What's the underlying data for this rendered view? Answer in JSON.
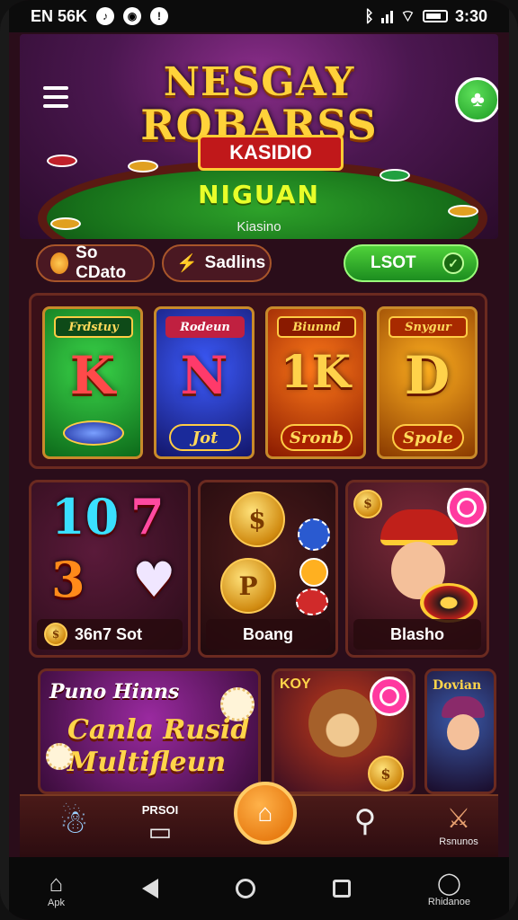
{
  "status_bar": {
    "left_text": "EN 56K",
    "time": "3:30"
  },
  "hero": {
    "title_line1": "NESGAY",
    "title_line2": "ROBARSS",
    "ribbon": "KASIDIO",
    "subtitle": "NIGUAN",
    "caption": "Kiasino"
  },
  "chips": {
    "coin_label": "So CDato",
    "spin_label": "Sadlins",
    "lsot_label": "LSOT"
  },
  "slots": [
    {
      "tag": "Frdstuy",
      "letter": "K",
      "button": "Jot"
    },
    {
      "tag": "Rodeun",
      "letter": "N",
      "button": "Jot"
    },
    {
      "tag": "Biunnd",
      "letter": "1K",
      "button": "Sronb"
    },
    {
      "tag": "Snygur",
      "letter": "D",
      "button": "Spole"
    }
  ],
  "cards": {
    "numbers_caption": "36n7 Sot",
    "coins_caption": "Boang",
    "man_caption": "Blasho",
    "promo_line1": "Puno Hinns",
    "promo_line2": "Canla Rusid",
    "promo_line3": "Multifleun",
    "bear_tag": "KOY",
    "lady_tag": "Dovian"
  },
  "bottom_nav": {
    "item2_label": "PRSOI",
    "item5_label": "Rsnunos"
  },
  "android_nav": {
    "home_label": "Apk",
    "profile_label": "Rhidanoe"
  },
  "colors": {
    "accent_gold": "#ffd23a",
    "accent_green": "#2ea32a",
    "background": "#2a0d1a",
    "pin_pink": "#ff3aa0"
  }
}
